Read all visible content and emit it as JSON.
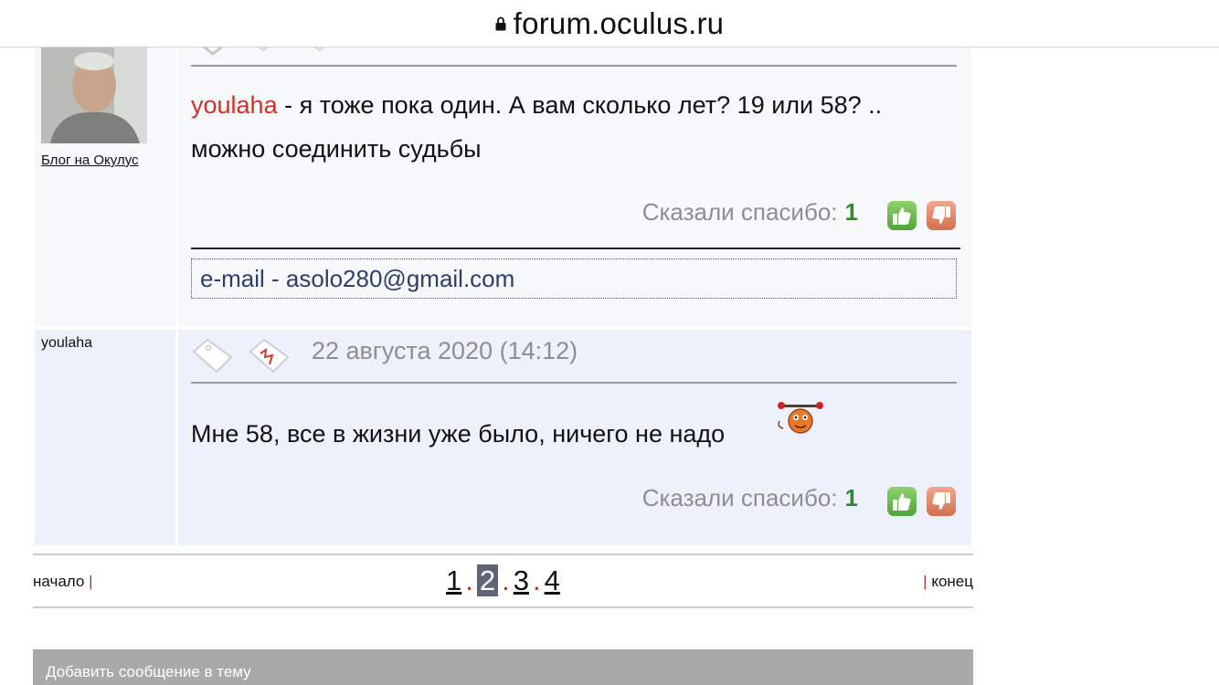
{
  "browser": {
    "host": "forum.oculus.ru"
  },
  "post1": {
    "blog_link": "Блог на Окулус",
    "nick": "youlaha",
    "text": " - я тоже пока один. А вам сколько лет? 19 или 58? .. можно соединить судьбы",
    "thanks_label": "Сказали спасибо:",
    "thanks_count": "1",
    "signature": "e-mail - asolo280@gmail.com"
  },
  "post2": {
    "author": "youlaha",
    "date": "22 августа 2020 (14:12)",
    "text": "Мне 58, все в жизни уже было, ничего не надо",
    "thanks_label": "Сказали спасибо:",
    "thanks_count": "1"
  },
  "pagination": {
    "start": "начало",
    "end": "конец",
    "sep": "|",
    "dot": ".",
    "pages": [
      "1",
      "2",
      "3",
      "4"
    ],
    "current": "2"
  },
  "footer": {
    "add_message": "Добавить сообщение в тему"
  },
  "colors": {
    "nick": "#d0302a",
    "thanks_count": "#2f8a2f",
    "current_page_bg": "#5e6577"
  },
  "icons": [
    "lock-icon",
    "tag-icon",
    "complaint-icon",
    "thumb-up-icon",
    "thumb-down-icon",
    "smiley-icon"
  ]
}
